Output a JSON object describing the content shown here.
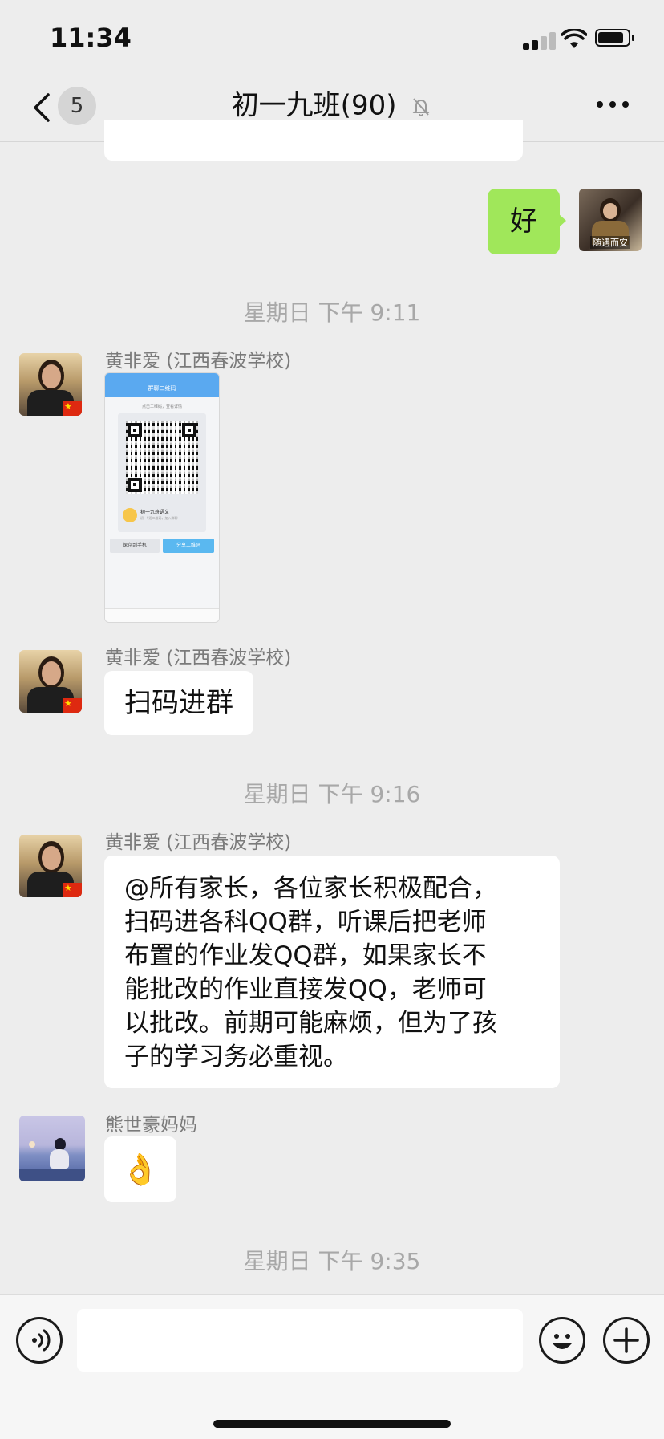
{
  "status": {
    "time": "11:34"
  },
  "nav": {
    "unread_count": "5",
    "title": "初一九班(90)",
    "back_icon": "chevron-left-icon",
    "mute_icon": "bell-slash-icon",
    "more_icon": "more-horizontal-icon"
  },
  "messages": [
    {
      "type": "text",
      "from": "me",
      "text": "好",
      "avatar_caption": "随遇而安"
    },
    {
      "type": "timestamp",
      "text": "星期日 下午 9:11"
    },
    {
      "type": "image",
      "sender": "黄非爱 (江西春波学校)",
      "qr_card": {
        "header": "群聊二维码",
        "hint": "点击二维码，查看详情",
        "group_name": "初一九班语文",
        "group_sub": "初一9班二维码，加入群聊",
        "save_label": "保存到手机",
        "share_label": "分享二维码"
      }
    },
    {
      "type": "text",
      "sender": "黄非爱 (江西春波学校)",
      "text": "扫码进群"
    },
    {
      "type": "timestamp",
      "text": "星期日 下午 9:16"
    },
    {
      "type": "text",
      "sender": "黄非爱 (江西春波学校)",
      "lines": [
        "@所有家长，各位家长积极配合，",
        "扫码进各科QQ群，听课后把老师",
        "布置的作业发QQ群，如果家长不",
        "能批改的作业直接发QQ，老师可",
        "以批改。前期可能麻烦，但为了孩",
        "子的学习务必重视。"
      ]
    },
    {
      "type": "emoji",
      "sender": "熊世豪妈妈",
      "emoji": "👌"
    },
    {
      "type": "timestamp",
      "text": "星期日 下午 9:35"
    }
  ],
  "input": {
    "voice_icon": "voice-icon",
    "emoji_icon": "smiley-icon",
    "plus_icon": "plus-icon"
  },
  "colors": {
    "background": "#ededed",
    "my_bubble": "#a0e75a",
    "other_bubble": "#ffffff",
    "timestamp": "#a8a8a8"
  }
}
